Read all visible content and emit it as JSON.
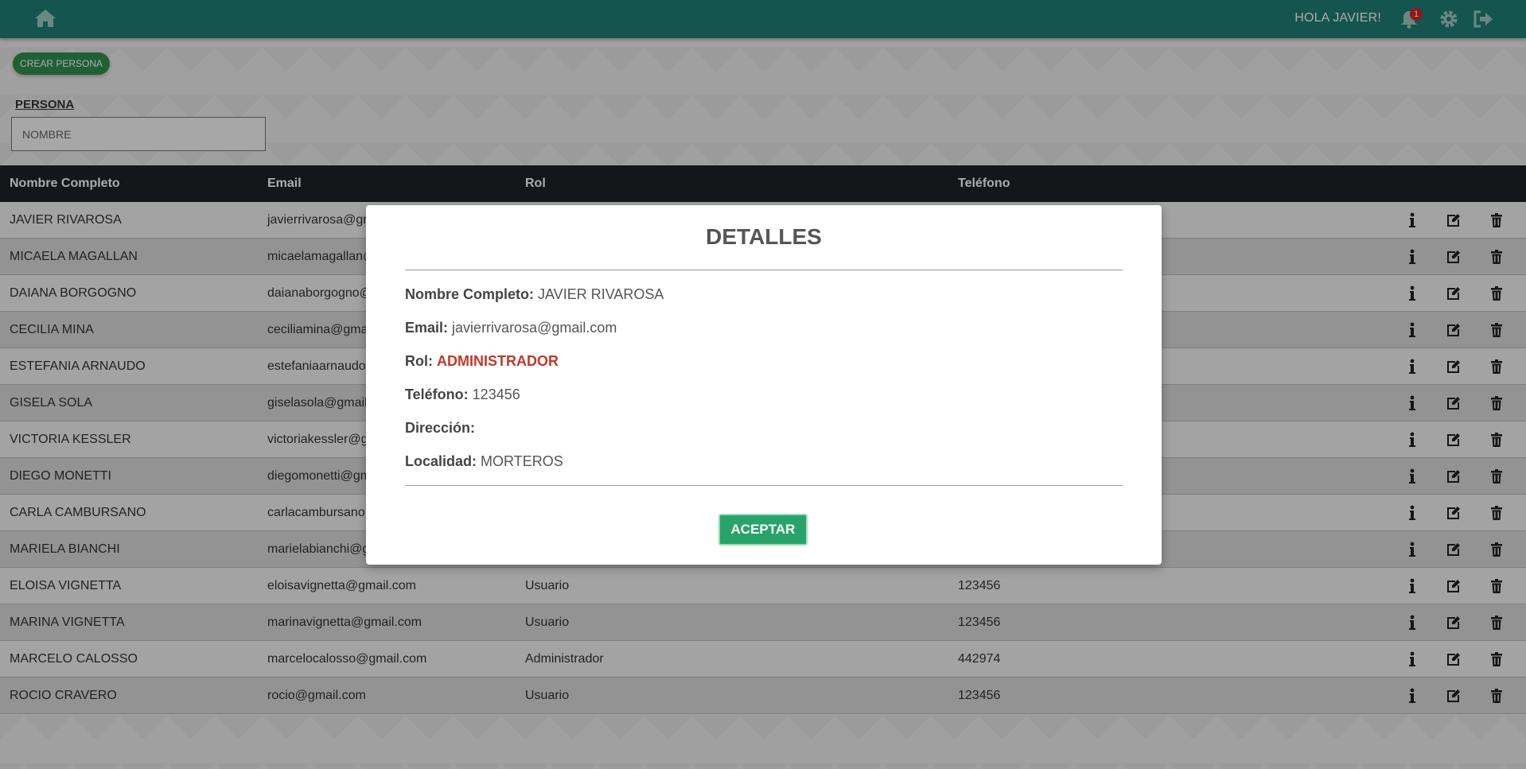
{
  "header": {
    "greeting": "HOLA JAVIER!",
    "notification_count": "1",
    "accent_color": "#1f7f77",
    "icons": [
      "home-icon",
      "bell-icon",
      "gear-icon",
      "logout-icon"
    ]
  },
  "toolbar": {
    "create_label": "CREAR PERSONA"
  },
  "filter": {
    "label": "PERSONA",
    "placeholder": "NOMBRE"
  },
  "table": {
    "headers": [
      "Nombre Completo",
      "Email",
      "Rol",
      "Teléfono"
    ],
    "rows": [
      {
        "name": "JAVIER RIVAROSA",
        "email": "javierrivarosa@gm",
        "rol": "",
        "tel": ""
      },
      {
        "name": "MICAELA MAGALLAN",
        "email": "micaelamagallan@",
        "rol": "",
        "tel": ""
      },
      {
        "name": "DAIANA BORGOGNO",
        "email": "daianaborgogno@",
        "rol": "",
        "tel": ""
      },
      {
        "name": "CECILIA MINA",
        "email": "ceciliamina@gmai",
        "rol": "",
        "tel": ""
      },
      {
        "name": "ESTEFANIA ARNAUDO",
        "email": "estefaniaarnaudo",
        "rol": "",
        "tel": ""
      },
      {
        "name": "GISELA SOLA",
        "email": "giselasola@gmail.",
        "rol": "",
        "tel": ""
      },
      {
        "name": "VICTORIA KESSLER",
        "email": "victoriakessler@g",
        "rol": "",
        "tel": ""
      },
      {
        "name": "DIEGO MONETTI",
        "email": "diegomonetti@gm",
        "rol": "",
        "tel": ""
      },
      {
        "name": "CARLA CAMBURSANO",
        "email": "carlacambursano@",
        "rol": "",
        "tel": ""
      },
      {
        "name": "MARIELA BIANCHI",
        "email": "marielabianchi@g",
        "rol": "",
        "tel": ""
      },
      {
        "name": "ELOISA VIGNETTA",
        "email": "eloisavignetta@gmail.com",
        "rol": "Usuario",
        "tel": "123456"
      },
      {
        "name": "MARINA VIGNETTA",
        "email": "marinavignetta@gmail.com",
        "rol": "Usuario",
        "tel": "123456"
      },
      {
        "name": "MARCELO CALOSSO",
        "email": "marcelocalosso@gmail.com",
        "rol": "Administrador",
        "tel": "442974"
      },
      {
        "name": "ROCIO CRAVERO",
        "email": "rocio@gmail.com",
        "rol": "Usuario",
        "tel": "123456"
      }
    ],
    "row_actions": [
      "info-icon",
      "edit-icon",
      "trash-icon"
    ]
  },
  "modal": {
    "title": "DETALLES",
    "fields": [
      {
        "label": "Nombre Completo:",
        "value": "JAVIER RIVAROSA"
      },
      {
        "label": "Email:",
        "value": "javierrivarosa@gmail.com"
      },
      {
        "label": "Rol:",
        "value": "ADMINISTRADOR"
      },
      {
        "label": "Teléfono:",
        "value": "123456"
      },
      {
        "label": "Dirección:",
        "value": ""
      },
      {
        "label": "Localidad:",
        "value": "MORTEROS"
      }
    ],
    "role_color": "#c0392b",
    "accept_label": "ACEPTAR"
  }
}
